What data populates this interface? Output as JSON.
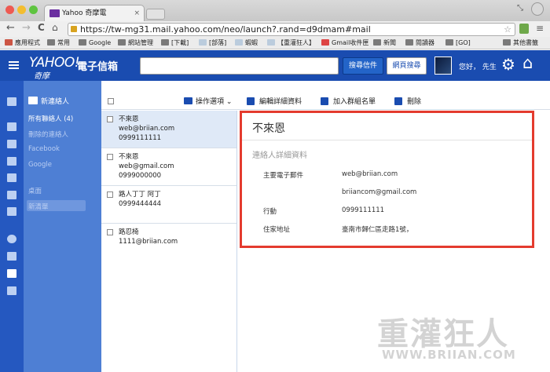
{
  "browser": {
    "tab_title": "Yahoo 奇摩電",
    "tab_close": "×",
    "url": "https://tw-mg31.mail.yahoo.com/neo/launch?.rand=d9dmam#mail",
    "nav": {
      "back": "←",
      "forward": "→",
      "reload": "C"
    }
  },
  "bookmarks": [
    "應用程式",
    "常用",
    "Google",
    "網站管理",
    "[下載]",
    "[部落]",
    "蝦蝦",
    "【重灌狂人】",
    "Gmail收件匣",
    "新聞",
    "閱讀器",
    "[GO]",
    "其他書籤"
  ],
  "header": {
    "logo": "YAHOO!",
    "logo_cn": "電子信箱",
    "logo_sub": "奇摩",
    "search_mail": "搜尋信件",
    "search_web": "網頁搜尋",
    "greeting": "您好， 先生",
    "colors": {
      "brand": "#1a4cb0",
      "highlight": "#e43b2e"
    }
  },
  "sidebar": {
    "new_contact": "新連絡人",
    "all_contacts": "所有聯絡人 (4)",
    "deleted": "刪除的連絡人",
    "facebook": "Facebook",
    "google": "Google",
    "desktop": "桌面",
    "new_list": "新清單"
  },
  "list": {
    "ops_label": "操作選項",
    "contacts": [
      {
        "name": "不來恩",
        "email": "web@briian.com",
        "phone": "0999111111"
      },
      {
        "name": "不來恩",
        "email": "web@gmail.com",
        "phone": "0999000000"
      },
      {
        "name": "路人丁丁 阿丁",
        "email": "",
        "phone": "0999444444"
      },
      {
        "name": "路忍椅",
        "email": "1111@briian.com",
        "phone": ""
      }
    ]
  },
  "actions": {
    "edit": "編輯詳細資料",
    "add_group": "加入群組名單",
    "delete": "刪除"
  },
  "detail": {
    "name": "不來恩",
    "section": "連絡人詳細資料",
    "primary_email_label": "主要電子郵件",
    "primary_email": "web@briian.com",
    "secondary_email": "briiancom@gmail.com",
    "mobile_label": "行動",
    "mobile": "0999111111",
    "address_label": "住家地址",
    "address": "臺南市歸仁區走路1號，"
  },
  "watermark": {
    "cn": "重灌狂人",
    "en": "WWW.BRIIAN.COM"
  }
}
